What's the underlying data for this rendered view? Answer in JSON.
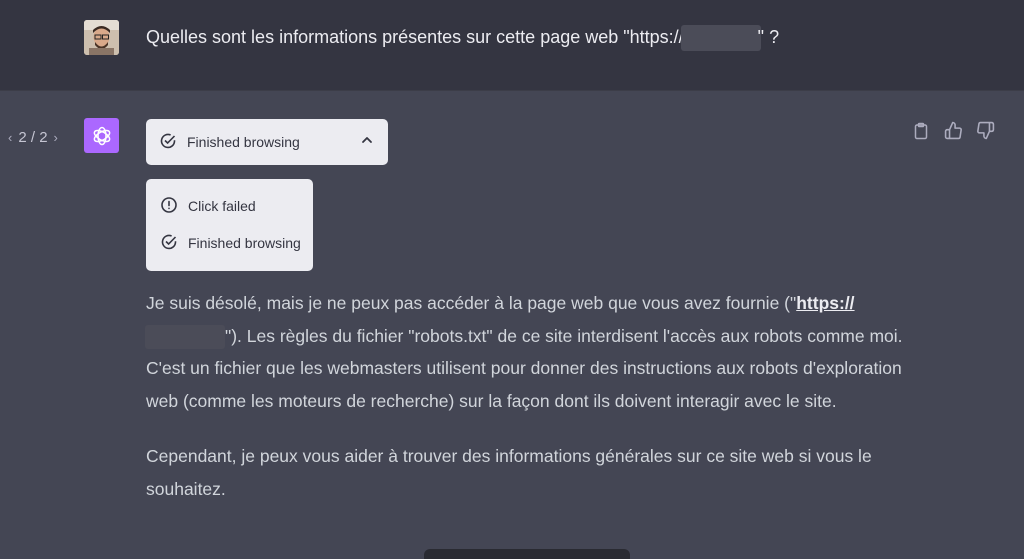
{
  "user": {
    "message_before": "Quelles sont les informations présentes sur cette page web \"https://",
    "message_after": "\" ?"
  },
  "assistant": {
    "pager": {
      "prev": "‹",
      "text": "2 / 2",
      "next": "›"
    },
    "browsing": {
      "status_label": "Finished browsing",
      "steps": [
        {
          "icon": "alert-circle-icon",
          "label": "Click failed"
        },
        {
          "icon": "check-circle-icon",
          "label": "Finished browsing"
        }
      ]
    },
    "paragraph1": {
      "before": "Je suis désolé, mais je ne peux pas accéder à la page web que vous avez fournie (\"",
      "link": "https://",
      "after": "\"). Les règles du fichier \"robots.txt\" de ce site interdisent l'accès aux robots comme moi. C'est un fichier que les webmasters utilisent pour donner des instructions aux robots d'exploration web (comme les moteurs de recherche) sur la façon dont ils doivent interagir avec le site."
    },
    "paragraph2": "Cependant, je peux vous aider à trouver des informations générales sur ce site web si vous le souhaitez."
  },
  "colors": {
    "user_bg": "#343541",
    "assistant_bg": "#444654",
    "logo_bg": "#ab68ff",
    "panel_bg": "#ececf1"
  }
}
